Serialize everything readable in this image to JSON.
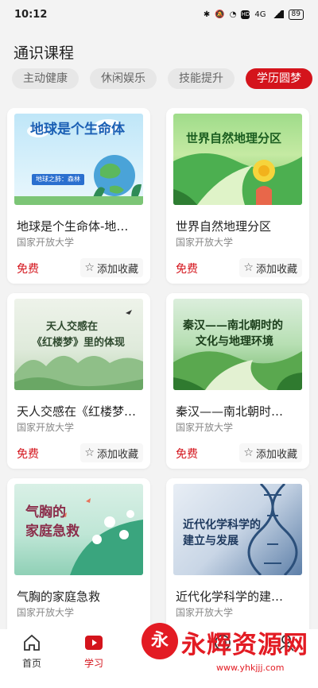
{
  "status_bar": {
    "time": "10:12",
    "network": "4G",
    "battery": "89"
  },
  "page": {
    "title": "通识课程"
  },
  "chips": [
    {
      "label": "主动健康"
    },
    {
      "label": "休闲娱乐"
    },
    {
      "label": "技能提升"
    },
    {
      "label": "学历圆梦"
    }
  ],
  "cards": [
    {
      "thumb_title": "地球是个生命体",
      "thumb_tag": "地球之肺：森林",
      "title": "地球是个生命体-地…",
      "provider": "国家开放大学",
      "price": "免费",
      "fav_label": "添加收藏"
    },
    {
      "thumb_title": "世界自然地理分区",
      "title": "世界自然地理分区",
      "provider": "国家开放大学",
      "price": "免费",
      "fav_label": "添加收藏"
    },
    {
      "thumb_title": "天人交感在《红楼梦》里的体现",
      "thumb_line1": "天人交感在",
      "thumb_line2": "《红楼梦》里的体现",
      "title": "天人交感在《红楼梦…",
      "provider": "国家开放大学",
      "price": "免费",
      "fav_label": "添加收藏"
    },
    {
      "thumb_line1": "秦汉——南北朝时的",
      "thumb_line2": "文化与地理环境",
      "title": "秦汉——南北朝时…",
      "provider": "国家开放大学",
      "price": "免费",
      "fav_label": "添加收藏"
    },
    {
      "thumb_line1": "气胸的",
      "thumb_line2": "家庭急救",
      "title": "气胸的家庭急救",
      "provider": "国家开放大学"
    },
    {
      "thumb_line1": "近代化学科学的",
      "thumb_line2": "建立与发展",
      "title": "近代化学科学的建…",
      "provider": "国家开放大学"
    }
  ],
  "nav": [
    {
      "label": "首页",
      "icon": "home-icon"
    },
    {
      "label": "学习",
      "icon": "play-icon"
    },
    {
      "label": "",
      "icon": "center-icon"
    },
    {
      "label": "",
      "icon": "target-icon"
    },
    {
      "label": "",
      "icon": "user-icon"
    }
  ],
  "watermark": {
    "logo": "永",
    "text": "永辉资源网",
    "url": "www.yhkjjj.com"
  },
  "colors": {
    "accent": "#d4141c",
    "background": "#f3f3f3"
  }
}
